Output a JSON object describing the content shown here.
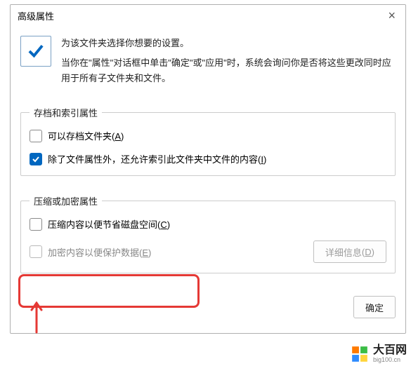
{
  "dialog": {
    "title": "高级属性",
    "intro": {
      "l1": "为该文件夹选择你想要的设置。",
      "l2": "当你在\"属性\"对话框中单击\"确定\"或\"应用\"时，系统会询问你是否将这些更改同时应用于所有子文件夹和文件。"
    },
    "g1": {
      "legend": "存档和索引属性",
      "o1": {
        "t": "可以存档文件夹",
        "k": "A",
        "chk": false
      },
      "o2": {
        "t": "除了文件属性外，还允许索引此文件夹中文件的内容",
        "k": "I",
        "chk": true
      }
    },
    "g2": {
      "legend": "压缩或加密属性",
      "o1": {
        "t": "压缩内容以便节省磁盘空间",
        "k": "C",
        "chk": false
      },
      "o2": {
        "t": "加密内容以便保护数据",
        "k": "E",
        "chk": false,
        "disabled": true
      },
      "details": {
        "t": "详细信息",
        "k": "D",
        "disabled": true
      }
    },
    "btns": {
      "ok": "确定"
    }
  },
  "wm": {
    "title": "大百网",
    "url": "big100.cn"
  }
}
